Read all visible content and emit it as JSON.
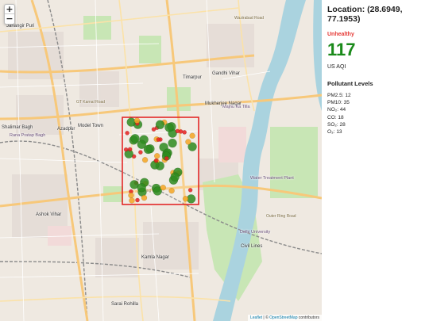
{
  "panel": {
    "location": "Location: (28.6949, 77.1953)",
    "status": "Unhealthy",
    "status_color": "#e53935",
    "aqi": "117",
    "aqi_color": "#1a8a1a",
    "aqi_unit": "US AQI",
    "pollutants_heading": "Pollutant Levels",
    "pollutants": [
      {
        "label": "PM2.5: 12"
      },
      {
        "label": "PM10: 35"
      },
      {
        "label": "NO₂: 44"
      },
      {
        "label": "CO: 18"
      },
      {
        "label": "SO₂: 28"
      },
      {
        "label": "O₃: 13"
      }
    ]
  },
  "map": {
    "zoom_in": "+",
    "zoom_out": "−",
    "attribution_prefix": "Leaflet",
    "attribution_sep": " | © ",
    "attribution_link": "OpenStreetMap",
    "attribution_suffix": " contributors",
    "labels": [
      {
        "text": "Jahangir Puri",
        "cls": "place"
      },
      {
        "text": "Model Town",
        "cls": "place"
      },
      {
        "text": "Azadpur",
        "cls": "place"
      },
      {
        "text": "Shalimar Bagh",
        "cls": "place"
      },
      {
        "text": "Ashok Vihar",
        "cls": "place"
      },
      {
        "text": "Gandhi Vihar",
        "cls": "place"
      },
      {
        "text": "Mukherjee Nagar",
        "cls": "place"
      },
      {
        "text": "Kamla Nagar",
        "cls": "place"
      },
      {
        "text": "Civil Lines",
        "cls": "place"
      },
      {
        "text": "Sarai Rohilla",
        "cls": "place"
      },
      {
        "text": "Timarpur",
        "cls": "place"
      },
      {
        "text": "Rana Pratap Bagh",
        "cls": "district"
      },
      {
        "text": "Majnu Ka Tilla",
        "cls": "district"
      },
      {
        "text": "Delhi University",
        "cls": "district"
      },
      {
        "text": "Water Treatment Plant",
        "cls": "district"
      },
      {
        "text": "Wazirabad Road",
        "cls": "road"
      },
      {
        "text": "GT Karnal Road",
        "cls": "road"
      },
      {
        "text": "Ring Road",
        "cls": "road"
      },
      {
        "text": "Outer Ring Road",
        "cls": "road"
      }
    ],
    "colors": {
      "good": "#2e8b1f",
      "moderate": "#f5a623",
      "unhealthy": "#e62020",
      "box": "#e21b1b",
      "river": "#aad3df",
      "park": "#c8e6b5"
    },
    "markers": [
      {
        "lvl": "good",
        "s": "l"
      },
      {
        "lvl": "good",
        "s": "l"
      },
      {
        "lvl": "moderate",
        "s": "m"
      },
      {
        "lvl": "unhealthy",
        "s": "s"
      },
      {
        "lvl": "good",
        "s": "l"
      },
      {
        "lvl": "moderate",
        "s": "m"
      },
      {
        "lvl": "good",
        "s": "l"
      },
      {
        "lvl": "unhealthy",
        "s": "s"
      },
      {
        "lvl": "good",
        "s": "l"
      },
      {
        "lvl": "moderate",
        "s": "m"
      },
      {
        "lvl": "good",
        "s": "l"
      },
      {
        "lvl": "good",
        "s": "l"
      },
      {
        "lvl": "unhealthy",
        "s": "s"
      },
      {
        "lvl": "moderate",
        "s": "m"
      },
      {
        "lvl": "good",
        "s": "l"
      },
      {
        "lvl": "good",
        "s": "l"
      },
      {
        "lvl": "unhealthy",
        "s": "s"
      },
      {
        "lvl": "moderate",
        "s": "m"
      },
      {
        "lvl": "good",
        "s": "l"
      },
      {
        "lvl": "unhealthy",
        "s": "s"
      },
      {
        "lvl": "good",
        "s": "l"
      },
      {
        "lvl": "moderate",
        "s": "m"
      },
      {
        "lvl": "good",
        "s": "l"
      },
      {
        "lvl": "unhealthy",
        "s": "s"
      },
      {
        "lvl": "good",
        "s": "l"
      },
      {
        "lvl": "moderate",
        "s": "m"
      },
      {
        "lvl": "good",
        "s": "l"
      },
      {
        "lvl": "unhealthy",
        "s": "s"
      },
      {
        "lvl": "good",
        "s": "l"
      },
      {
        "lvl": "moderate",
        "s": "m"
      },
      {
        "lvl": "good",
        "s": "l"
      },
      {
        "lvl": "unhealthy",
        "s": "s"
      },
      {
        "lvl": "good",
        "s": "l"
      },
      {
        "lvl": "moderate",
        "s": "m"
      },
      {
        "lvl": "good",
        "s": "l"
      },
      {
        "lvl": "unhealthy",
        "s": "s"
      },
      {
        "lvl": "good",
        "s": "l"
      },
      {
        "lvl": "moderate",
        "s": "m"
      },
      {
        "lvl": "unhealthy",
        "s": "s"
      },
      {
        "lvl": "good",
        "s": "l"
      },
      {
        "lvl": "moderate",
        "s": "m"
      },
      {
        "lvl": "good",
        "s": "l"
      },
      {
        "lvl": "unhealthy",
        "s": "s"
      },
      {
        "lvl": "good",
        "s": "l"
      },
      {
        "lvl": "moderate",
        "s": "m"
      },
      {
        "lvl": "unhealthy",
        "s": "s"
      },
      {
        "lvl": "good",
        "s": "l"
      },
      {
        "lvl": "moderate",
        "s": "m"
      },
      {
        "lvl": "good",
        "s": "l"
      },
      {
        "lvl": "unhealthy",
        "s": "s"
      },
      {
        "lvl": "good",
        "s": "l"
      },
      {
        "lvl": "moderate",
        "s": "m"
      },
      {
        "lvl": "unhealthy",
        "s": "s"
      },
      {
        "lvl": "good",
        "s": "l"
      },
      {
        "lvl": "moderate",
        "s": "m"
      },
      {
        "lvl": "good",
        "s": "l"
      },
      {
        "lvl": "unhealthy",
        "s": "s"
      },
      {
        "lvl": "good",
        "s": "l"
      },
      {
        "lvl": "moderate",
        "s": "m"
      },
      {
        "lvl": "unhealthy",
        "s": "s"
      },
      {
        "lvl": "good",
        "s": "l"
      },
      {
        "lvl": "moderate",
        "s": "m"
      },
      {
        "lvl": "unhealthy",
        "s": "s"
      },
      {
        "lvl": "good",
        "s": "l"
      },
      {
        "lvl": "unhealthy",
        "s": "s"
      },
      {
        "lvl": "moderate",
        "s": "m"
      },
      {
        "lvl": "good",
        "s": "l"
      },
      {
        "lvl": "unhealthy",
        "s": "s"
      }
    ]
  }
}
